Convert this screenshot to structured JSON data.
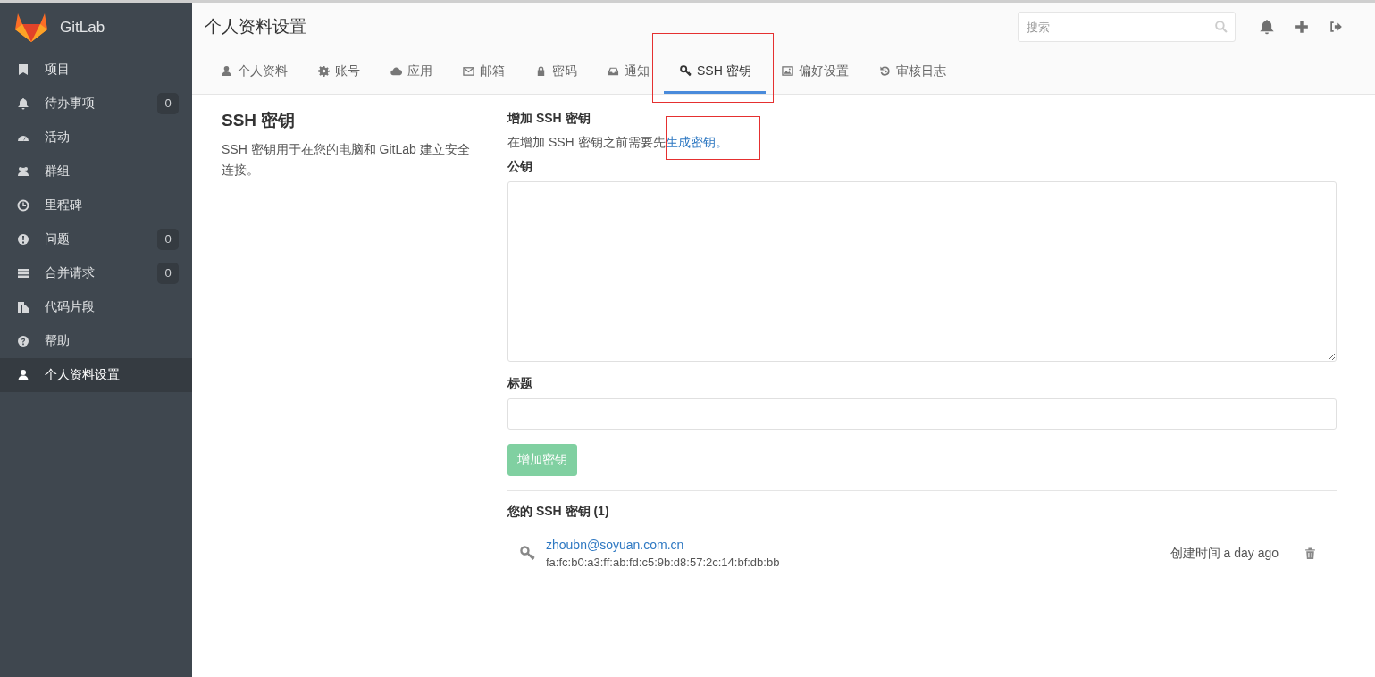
{
  "brand": {
    "name": "GitLab"
  },
  "sidebar": {
    "items": [
      {
        "label": "项目",
        "selected": false
      },
      {
        "label": "待办事项",
        "badge": "0",
        "selected": false
      },
      {
        "label": "活动",
        "selected": false
      },
      {
        "label": "群组",
        "selected": false
      },
      {
        "label": "里程碑",
        "selected": false
      },
      {
        "label": "问题",
        "badge": "0",
        "selected": false
      },
      {
        "label": "合并请求",
        "badge": "0",
        "selected": false
      },
      {
        "label": "代码片段",
        "selected": false
      },
      {
        "label": "帮助",
        "selected": false
      },
      {
        "label": "个人资料设置",
        "selected": true
      }
    ]
  },
  "header": {
    "title": "个人资料设置",
    "search": {
      "placeholder": "搜索"
    }
  },
  "tabs": [
    {
      "label": "个人资料",
      "selected": false
    },
    {
      "label": "账号",
      "selected": false
    },
    {
      "label": "应用",
      "selected": false
    },
    {
      "label": "邮箱",
      "selected": false
    },
    {
      "label": "密码",
      "selected": false
    },
    {
      "label": "通知",
      "selected": false
    },
    {
      "label": "SSH 密钥",
      "selected": true
    },
    {
      "label": "偏好设置",
      "selected": false
    },
    {
      "label": "审核日志",
      "selected": false
    }
  ],
  "intro": {
    "title": "SSH 密钥",
    "description": "SSH 密钥用于在您的电脑和 GitLab 建立安全连接。"
  },
  "form": {
    "title": "增加 SSH 密钥",
    "hint": "在增加 SSH 密钥之前需要先",
    "hint_link": "生成密钥。",
    "key_label": "公钥",
    "title_label": "标题",
    "submit": {
      "label": "增加密钥",
      "disabled": true
    }
  },
  "keys": {
    "heading": "您的 SSH 密钥 (1)",
    "items": [
      {
        "title": "zhoubn@soyuan.com.cn",
        "fingerprint": "fa:fc:b0:a3:ff:ab:fd:c5:9b:d8:57:2c:14:bf:db:bb",
        "created_label": "创建时间",
        "created": "a day ago"
      }
    ]
  }
}
